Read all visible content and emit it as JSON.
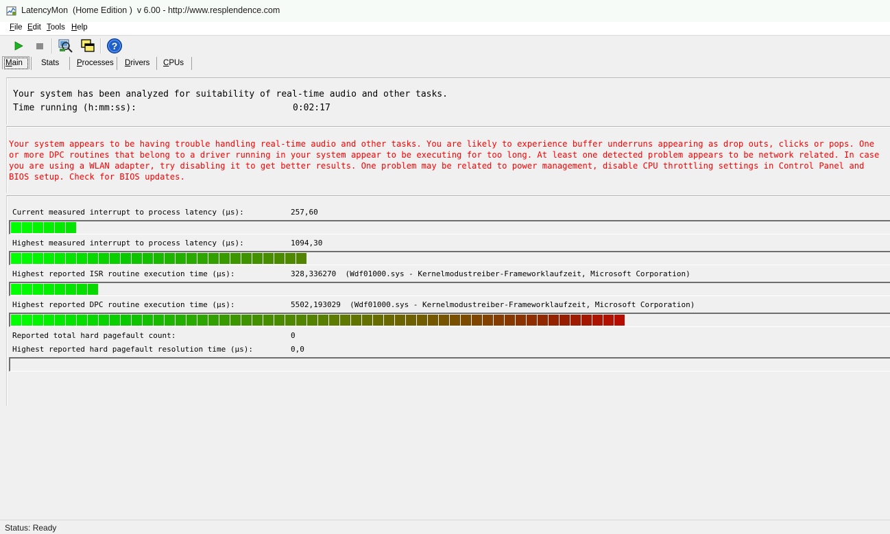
{
  "window": {
    "title": "LatencyMon  (Home Edition )  v 6.00 - http://www.resplendence.com",
    "icon": "latencymon-app-icon"
  },
  "menu": [
    {
      "prefix": "",
      "key": "F",
      "rest": "ile"
    },
    {
      "prefix": "",
      "key": "E",
      "rest": "dit"
    },
    {
      "prefix": "",
      "key": "T",
      "rest": "ools"
    },
    {
      "prefix": "",
      "key": "H",
      "rest": "elp"
    }
  ],
  "toolbar": {
    "buttons": [
      "play-icon",
      "stop-icon",
      "analyze-icon",
      "windows-icon",
      "help-icon"
    ],
    "colors": {
      "play": "#1fb41f",
      "stop": "#8c8c8c",
      "help": "#1f5fc8"
    }
  },
  "tabs": {
    "items": [
      {
        "key": "M",
        "rest": "ain"
      },
      {
        "key": "",
        "rest": "Stats"
      },
      {
        "key": "P",
        "rest": "rocesses"
      },
      {
        "key": "D",
        "rest": "rivers"
      },
      {
        "key": "C",
        "rest": "PUs"
      }
    ],
    "active": "Main"
  },
  "summary": {
    "message": "Your system has been analyzed for suitability of real-time audio and other tasks.",
    "time_label": "Time running (h:mm:ss):",
    "time_value": "0:02:17"
  },
  "warning": {
    "color": "#ff0000",
    "lines": [
      "Your system appears to be having trouble handling real-time audio and other tasks. You are likely to experience buffer underruns appearing as drop outs, clicks or pops. One",
      "or more DPC routines that belong to a driver running in your system appear to be executing for too long. At least one detected problem appears to be network related. In case",
      "you are using a WLAN adapter, try disabling it to get better results. One problem may be related to power management, disable CPU throttling settings in Control Panel and",
      "BIOS setup. Check for BIOS updates."
    ]
  },
  "metrics": [
    {
      "label": "Current measured interrupt to process latency (µs):",
      "value": "257,60",
      "bar_blocks": 6
    },
    {
      "label": "Highest measured interrupt to process latency (µs):",
      "value": "1094,30",
      "bar_blocks": 27
    },
    {
      "label": "Highest reported ISR routine execution time (µs):",
      "value": "328,336270  (Wdf01000.sys - Kernelmodustreiber-Frameworklaufzeit, Microsoft Corporation)",
      "bar_blocks": 8
    },
    {
      "label": "Highest reported DPC routine execution time (µs):",
      "value": "5502,193029  (Wdf01000.sys - Kernelmodustreiber-Frameworklaufzeit, Microsoft Corporation)",
      "bar_blocks": 56
    },
    {
      "label": "Reported total hard pagefault count:",
      "value": "0"
    },
    {
      "label": "Highest reported hard pagefault resolution time (µs):",
      "value": "0,0",
      "bar_blocks": 0
    }
  ],
  "status": {
    "text": "Status: Ready"
  }
}
